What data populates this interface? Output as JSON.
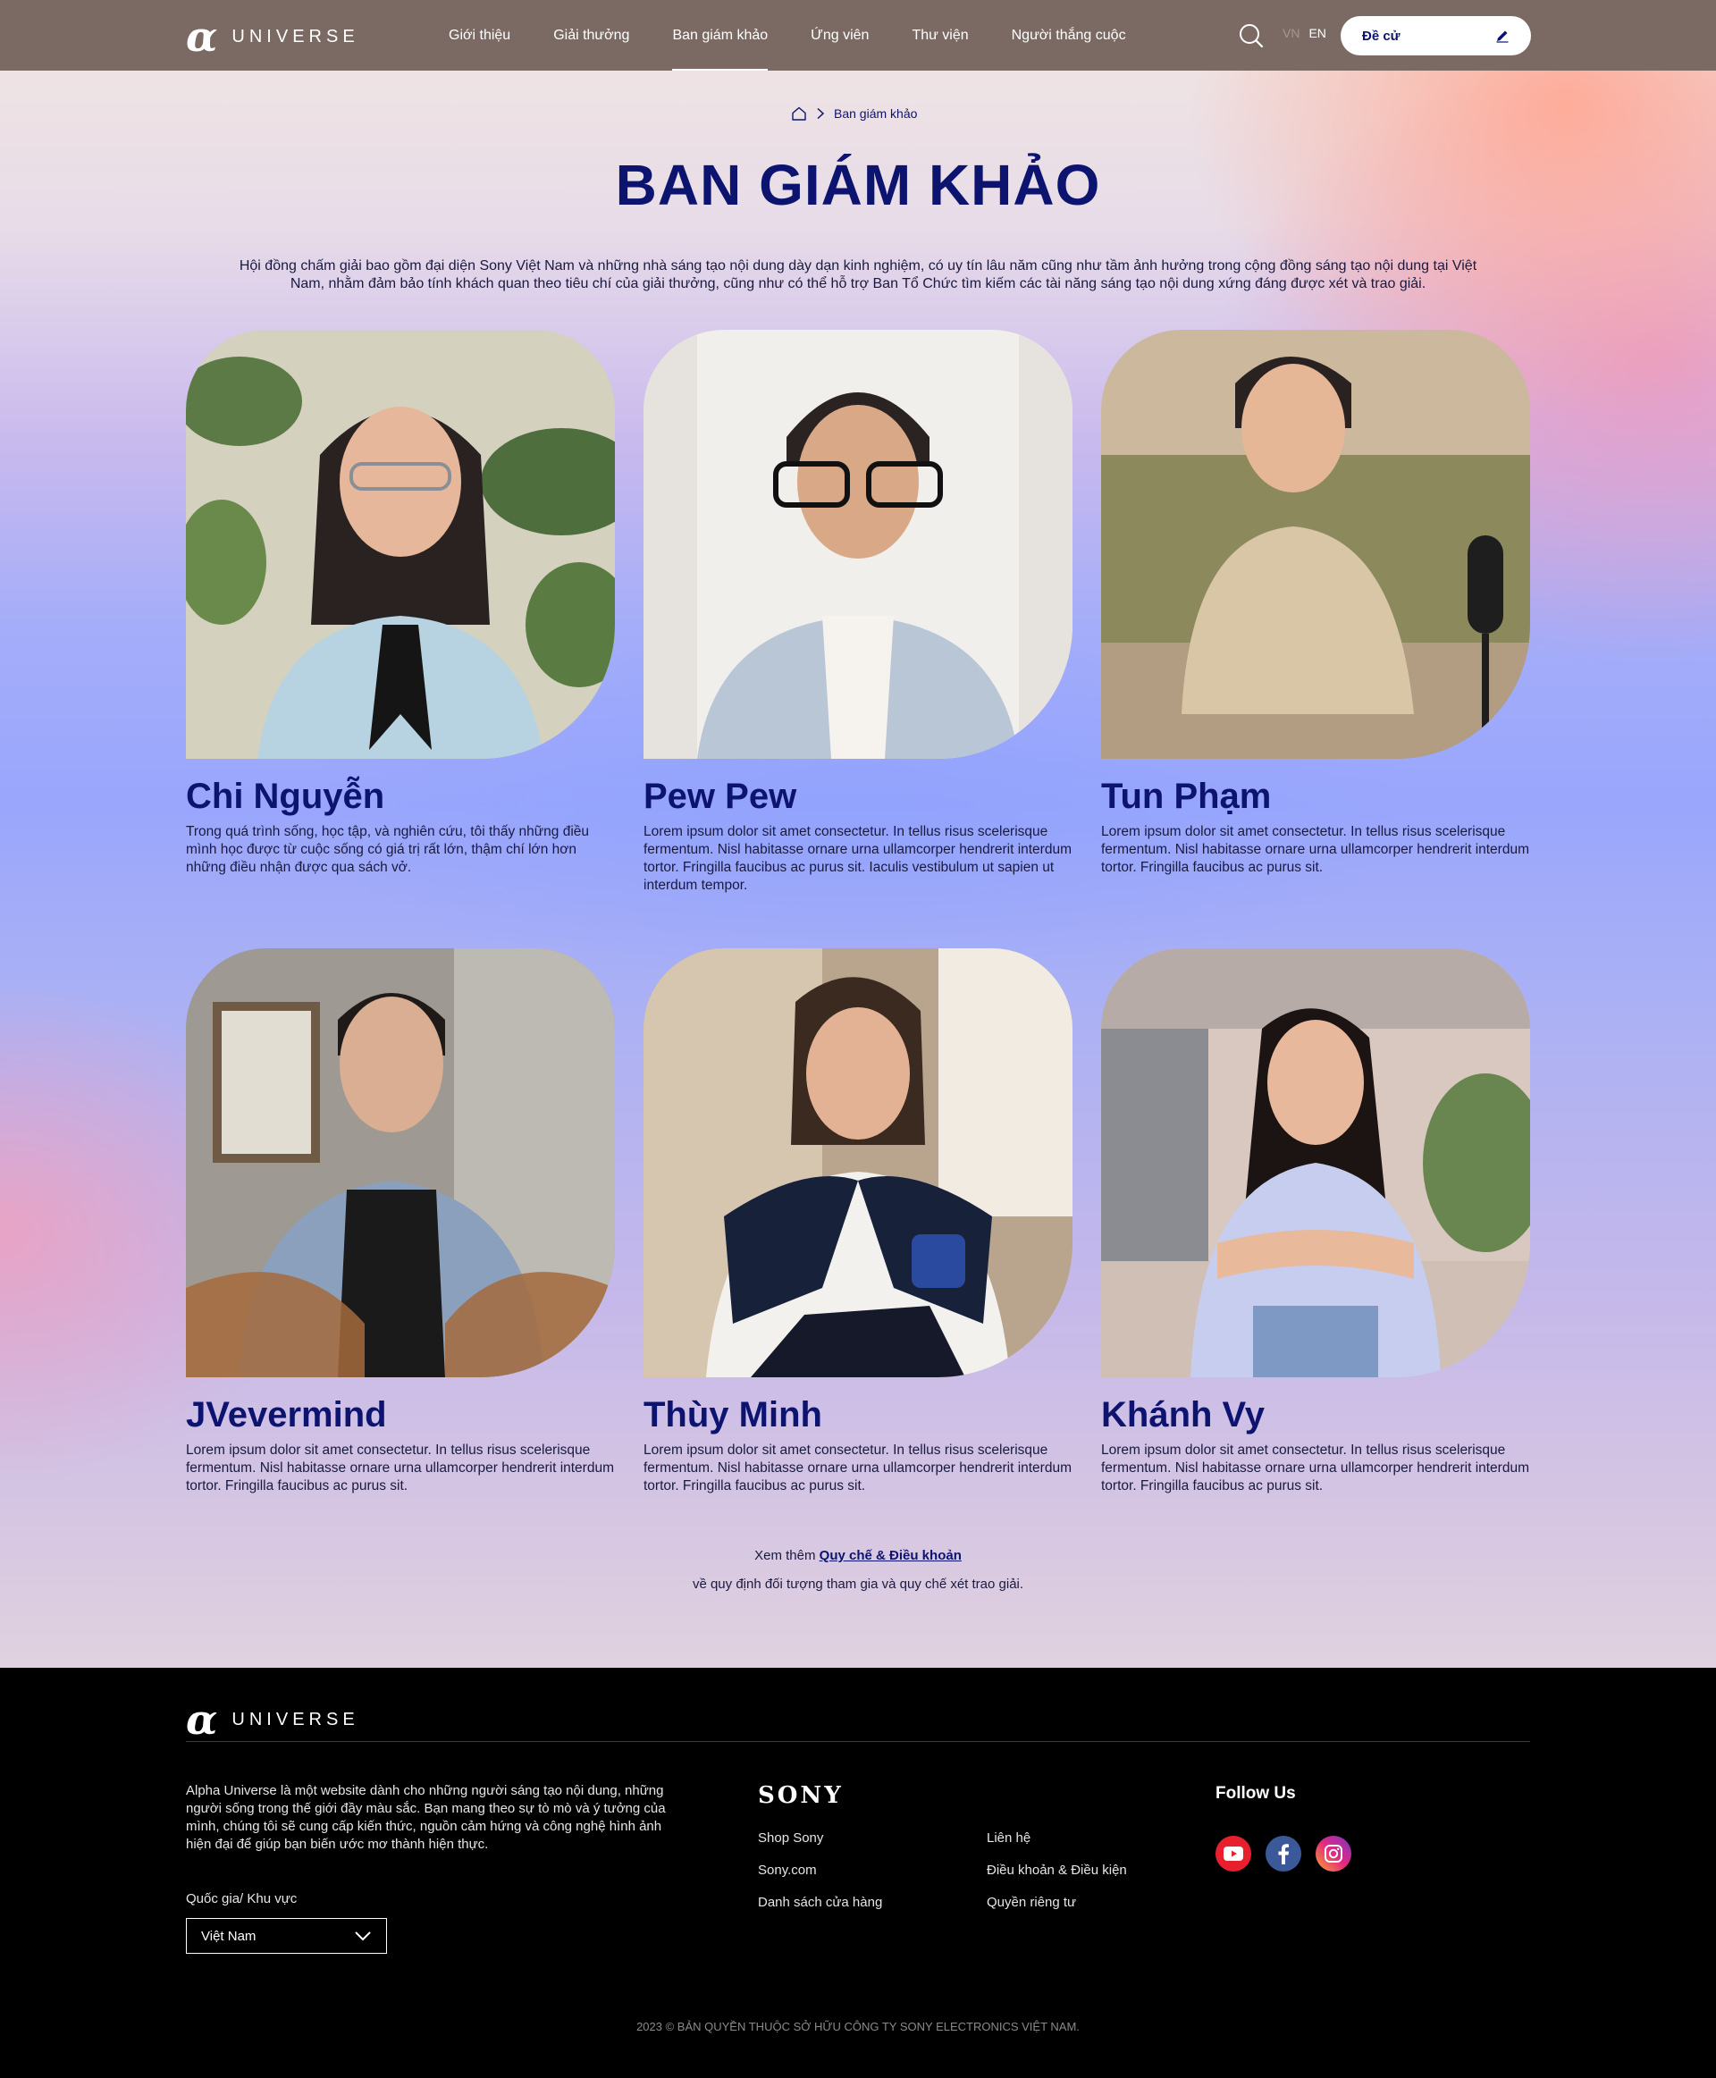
{
  "brand": {
    "word": "UNIVERSE",
    "symbol": "α"
  },
  "nav": {
    "items": [
      "Giới thiệu",
      "Giải thưởng",
      "Ban giám khảo",
      "Ứng viên",
      "Thư viện",
      "Người thắng cuộc"
    ],
    "active_index": 2
  },
  "lang": {
    "vn": "VN",
    "en": "EN"
  },
  "nominate_label": "Đề cử",
  "breadcrumb": {
    "current": "Ban giám khảo"
  },
  "page_title": "BAN GIÁM KHẢO",
  "intro": "Hội đồng chấm giải bao gồm đại diện Sony Việt Nam và những nhà sáng tạo nội dung dày dạn kinh nghiệm, có uy tín lâu năm cũng như tầm ảnh hưởng trong cộng đồng sáng tạo nội dung tại Việt Nam, nhằm đảm bảo tính khách quan theo tiêu chí của giải thưởng, cũng như có thể hỗ trợ Ban Tổ Chức tìm kiếm các tài năng sáng tạo nội dung xứng đáng được xét và trao giải.",
  "judges": [
    {
      "name": "Chi Nguyễn",
      "bio": "Trong quá trình sống, học tập, và nghiên cứu, tôi thấy những điều mình học được từ cuộc sống có giá trị rất lớn, thậm chí lớn hơn những điều nhận được qua sách vở."
    },
    {
      "name": "Pew Pew",
      "bio": "Lorem ipsum dolor sit amet consectetur. In tellus risus scelerisque fermentum. Nisl habitasse ornare urna ullamcorper hendrerit interdum tortor. Fringilla faucibus ac purus sit. Iaculis vestibulum ut sapien ut interdum tempor."
    },
    {
      "name": "Tun Phạm",
      "bio": "Lorem ipsum dolor sit amet consectetur. In tellus risus scelerisque fermentum. Nisl habitasse ornare urna ullamcorper hendrerit interdum tortor. Fringilla faucibus ac purus sit."
    },
    {
      "name": "JVevermind",
      "bio": "Lorem ipsum dolor sit amet consectetur. In tellus risus scelerisque fermentum. Nisl habitasse ornare urna ullamcorper hendrerit interdum tortor. Fringilla faucibus ac purus sit."
    },
    {
      "name": "Thùy Minh",
      "bio": "Lorem ipsum dolor sit amet consectetur. In tellus risus scelerisque fermentum. Nisl habitasse ornare urna ullamcorper hendrerit interdum tortor. Fringilla faucibus ac purus sit."
    },
    {
      "name": "Khánh Vy",
      "bio": "Lorem ipsum dolor sit amet consectetur. In tellus risus scelerisque fermentum. Nisl habitasse ornare urna ullamcorper hendrerit interdum tortor. Fringilla faucibus ac purus sit."
    }
  ],
  "more": {
    "prefix": "Xem thêm",
    "link": "Quy chế & Điều khoản",
    "suffix": "về quy định đối tượng tham gia và quy chế xét trao giải."
  },
  "footer": {
    "about": "Alpha Universe là một website dành cho những người sáng tạo nội dung, những người sống trong thế giới đầy màu sắc. Bạn mang theo sự tò mò và ý tưởng của mình, chúng tôi sẽ cung cấp kiến thức, nguồn cảm hứng và công nghệ hình ảnh hiện đại để giúp bạn biến ước mơ thành hiện thực.",
    "region_label": "Quốc gia/ Khu vực",
    "region_value": "Việt Nam",
    "sony": "SONY",
    "links_col1": [
      "Shop Sony",
      "Sony.com",
      "Danh sách cửa hàng"
    ],
    "links_col2": [
      "Liên hệ",
      "Điều khoản & Điều kiện",
      "Quyền riêng tư"
    ],
    "follow": "Follow Us",
    "social": [
      "youtube-icon",
      "facebook-icon",
      "instagram-icon"
    ],
    "copyright": "2023 © BẢN QUYỀN THUỘC SỞ HỮU CÔNG TY SONY ELECTRONICS VIỆT NAM."
  },
  "colors": {
    "accent": "#0d1470",
    "header_bg": "#7b6a63",
    "footer_bg": "#000000"
  }
}
